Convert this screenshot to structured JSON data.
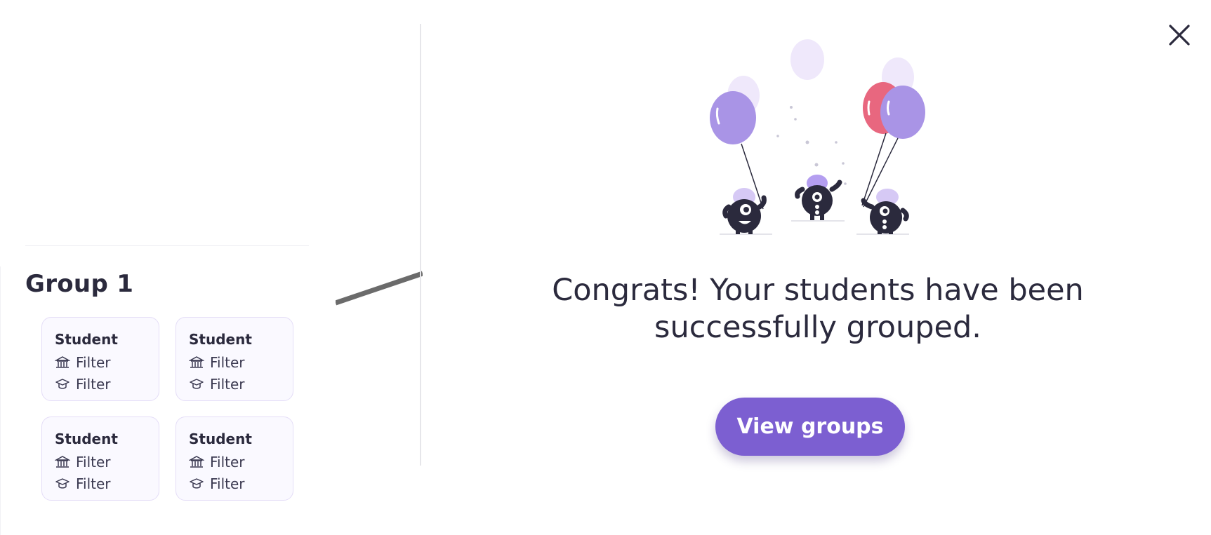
{
  "left_panel": {
    "group_title": "Group 1",
    "students": [
      {
        "name": "Student",
        "filters": [
          {
            "icon": "building-icon",
            "label": "Filter"
          },
          {
            "icon": "graduation-cap-icon",
            "label": "Filter"
          }
        ]
      },
      {
        "name": "Student",
        "filters": [
          {
            "icon": "building-icon",
            "label": "Filter"
          },
          {
            "icon": "graduation-cap-icon",
            "label": "Filter"
          }
        ]
      },
      {
        "name": "Student",
        "filters": [
          {
            "icon": "building-icon",
            "label": "Filter"
          },
          {
            "icon": "graduation-cap-icon",
            "label": "Filter"
          }
        ]
      },
      {
        "name": "Student",
        "filters": [
          {
            "icon": "building-icon",
            "label": "Filter"
          },
          {
            "icon": "graduation-cap-icon",
            "label": "Filter"
          }
        ]
      }
    ]
  },
  "modal": {
    "message": "Congrats! Your students have been successfully grouped.",
    "primary_button": "View groups",
    "close_icon": "close-icon",
    "illustration": "celebrating-monsters-with-balloons"
  },
  "colors": {
    "accent": "#7c5fd1",
    "text": "#2b2a3d",
    "card_border": "#e4ddf7",
    "card_bg": "#faf9ff",
    "balloon_purple": "#a994e6",
    "balloon_red": "#e8677f",
    "balloon_light": "#efe8fb"
  }
}
